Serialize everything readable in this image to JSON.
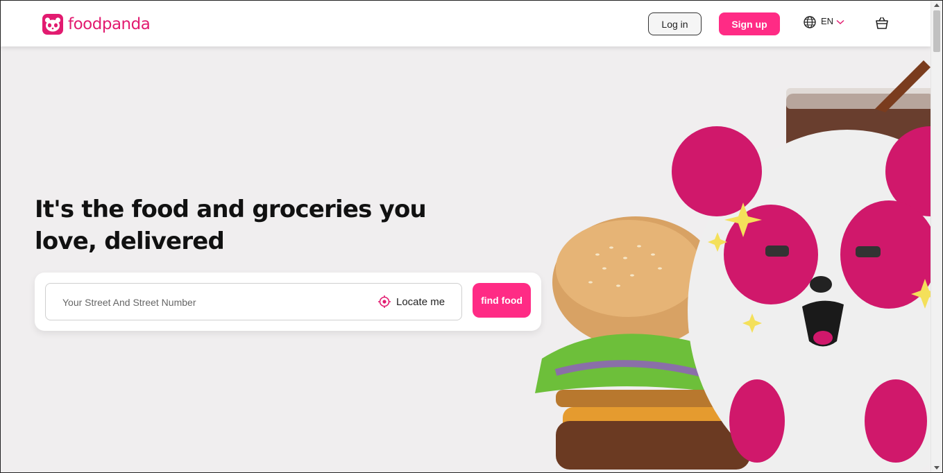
{
  "header": {
    "logo_text": "foodpanda",
    "login_label": "Log in",
    "signup_label": "Sign up",
    "language_code": "EN",
    "icons": [
      "foodpanda-logo-icon",
      "globe-icon",
      "chevron-down-icon",
      "shopping-bag-icon"
    ]
  },
  "hero": {
    "headline": "It's the food and groceries you love, delivered",
    "search": {
      "placeholder": "Your Street And Street Number",
      "locate_label": "Locate me",
      "submit_label": "find food"
    }
  },
  "colors": {
    "brand_pink": "#e21b70",
    "button_pink": "#ff2b85",
    "background": "#f0eeef"
  }
}
